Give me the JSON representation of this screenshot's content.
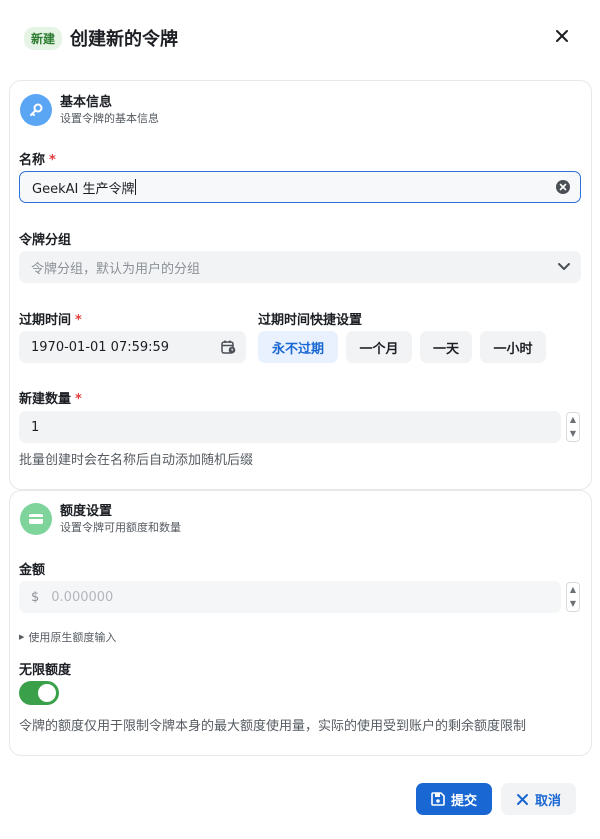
{
  "header": {
    "badge": "新建",
    "title": "创建新的令牌"
  },
  "basic": {
    "title": "基本信息",
    "subtitle": "设置令牌的基本信息",
    "name_label": "名称",
    "name_value": "GeekAI 生产令牌",
    "group_label": "令牌分组",
    "group_placeholder": "令牌分组，默认为用户的分组",
    "expire_label": "过期时间",
    "expire_value": "1970-01-01 07:59:59",
    "quick_label": "过期时间快捷设置",
    "quick_options": [
      "永不过期",
      "一个月",
      "一天",
      "一小时"
    ],
    "quick_selected": "永不过期",
    "count_label": "新建数量",
    "count_value": "1",
    "count_hint": "批量创建时会在名称后自动添加随机后缀",
    "required_mark": "*"
  },
  "quota": {
    "title": "额度设置",
    "subtitle": "设置令牌可用额度和数量",
    "amount_label": "金额",
    "amount_prefix": "$",
    "amount_placeholder": "0.000000",
    "raw_input_link": "使用原生额度输入",
    "unlimited_label": "无限额度",
    "unlimited_on": true,
    "unlimited_hint": "令牌的额度仅用于限制令牌本身的最大额度使用量，实际的使用受到账户的剩余额度限制"
  },
  "footer": {
    "submit_label": "提交",
    "cancel_label": "取消"
  },
  "colors": {
    "accent": "#1967d2",
    "toggle_on": "#3aa14a",
    "required": "#e03e3e"
  }
}
